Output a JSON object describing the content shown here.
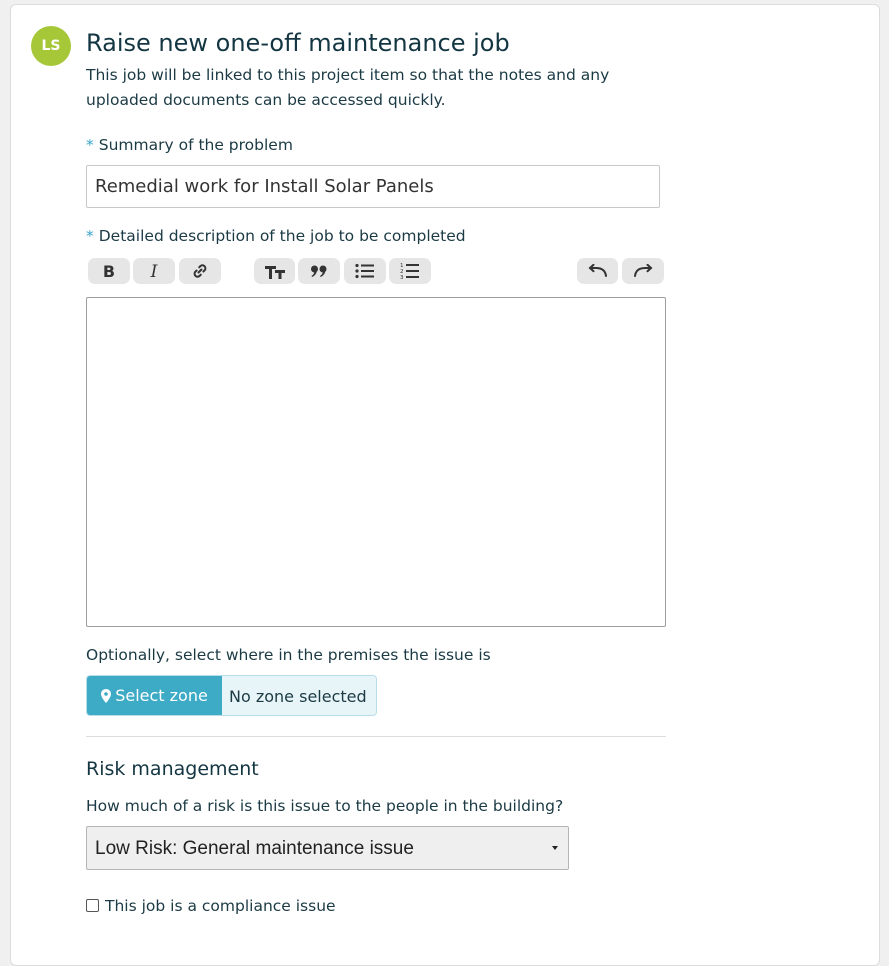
{
  "avatar": {
    "initials": "LS",
    "color": "#a6c737"
  },
  "form": {
    "title": "Raise new one-off maintenance job",
    "intro": "This job will be linked to this project item so that the notes and any uploaded documents can be accessed quickly.",
    "summary": {
      "label": "Summary of the problem",
      "required_marker": "*",
      "value": "Remedial work for Install Solar Panels"
    },
    "description": {
      "label": "Detailed description of the job to be completed",
      "required_marker": "*",
      "value": ""
    },
    "toolbar": {
      "buttons": [
        "bold-icon",
        "italic-icon",
        "link-icon",
        "heading-icon",
        "quote-icon",
        "bullet-list-icon",
        "numbered-list-icon",
        "undo-icon",
        "redo-icon"
      ]
    },
    "zone": {
      "label": "Optionally, select where in the premises the issue is",
      "button_label": "Select zone",
      "status": "No zone selected",
      "accent": "#3daac6"
    },
    "risk": {
      "heading": "Risk management",
      "question": "How much of a risk is this issue to the people in the building?",
      "selected": "Low Risk: General maintenance issue"
    },
    "compliance": {
      "label": "This job is a compliance issue",
      "checked": false
    }
  }
}
